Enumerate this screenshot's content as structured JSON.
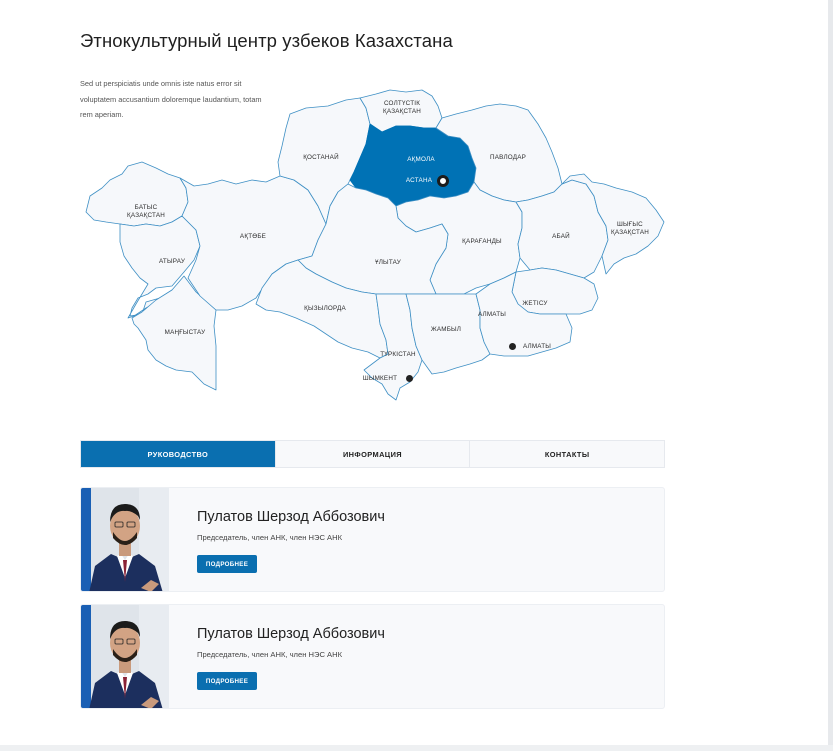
{
  "header": {
    "title": "Этнокультурный центр узбеков Казахстана",
    "intro": "Sed ut perspiciatis unde omnis iste natus error sit voluptatem accusantium doloremque laudantium, totam rem aperiam."
  },
  "map": {
    "active_region": "АҚМОЛА",
    "accent_color": "#0072b5",
    "regions": {
      "soltustik": "СОЛТҮСТІК\nҚАЗАҚСТАН",
      "kostanai": "ҚОСТАНАЙ",
      "akmola": "АҚМОЛА",
      "astana": "АСТАНА",
      "pavlodar": "ПАВЛОДАР",
      "batys": "БАТЫС\nҚАЗАҚСТАН",
      "aktobe": "АҚТӨБЕ",
      "karagandy": "ҚАРАҒАНДЫ",
      "abai": "АБАЙ",
      "shygys": "ШЫҒЫС\nҚАЗАҚСТАН",
      "atyrau": "АТЫРАУ",
      "ulytau": "ҰЛЫТАУ",
      "kyzylorda": "ҚЫЗЫЛОРДА",
      "zhetisu": "ЖЕТІСУ",
      "almaty_region": "АЛМАТЫ",
      "mangystau": "МАҢҒЫСТАУ",
      "zhambyl": "ЖАМБЫЛ",
      "almaty_city": "АЛМАТЫ",
      "turkistan": "ТҮРКІСТАН",
      "shymkent": "ШЫМКЕНТ"
    }
  },
  "tabs": [
    {
      "label": "РУКОВОДСТВО",
      "active": true
    },
    {
      "label": "ИНФОРМАЦИЯ",
      "active": false
    },
    {
      "label": "КОНТАКТЫ",
      "active": false
    }
  ],
  "people": [
    {
      "name": "Пулатов Шерзод Аббозович",
      "role": "Председатель, член АНК, член НЭС АНК",
      "button": "ПОДРОБНЕЕ"
    },
    {
      "name": "Пулатов Шерзод Аббозович",
      "role": "Председатель, член АНК, член НЭС АНК",
      "button": "ПОДРОБНЕЕ"
    }
  ]
}
